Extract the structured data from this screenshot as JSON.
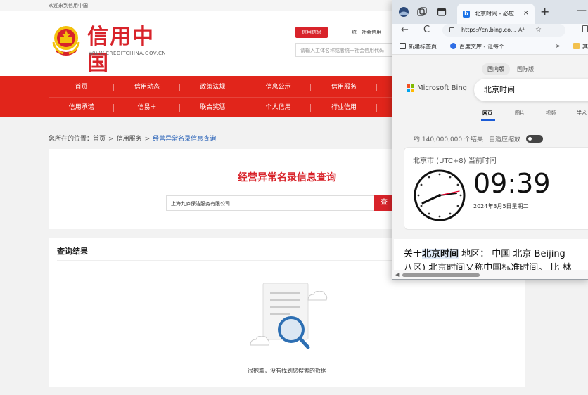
{
  "page": {
    "welcome": "欢迎来到信用中国",
    "logo": {
      "title": "信用中国",
      "subtitle": "WWW.CREDITCHINA.GOV.CN"
    },
    "search_tabs": {
      "active": "信用信息",
      "other": "统一社会信用"
    },
    "search_placeholder": "请输入主体名称或者统一社会信用代码",
    "nav_row1": [
      "首页",
      "信用动态",
      "政策法规",
      "信息公示",
      "信用服务",
      ""
    ],
    "nav_row2": [
      "信用承诺",
      "信易＋",
      "联合奖惩",
      "个人信用",
      "行业信用",
      ""
    ],
    "breadcrumb": {
      "prefix": "您所在的位置：",
      "home": "首页",
      "section": "信用服务",
      "current": "经营异常名录信息查询"
    },
    "query": {
      "title": "经营异常名录信息查询",
      "input_value": "上海九庐保洁服务有限公司",
      "button": "查"
    },
    "results": {
      "heading": "查询结果",
      "empty_text": "很抱歉，没有找到您搜索的数据"
    }
  },
  "browser": {
    "tab_title": "北京时间 - 必应",
    "tab_close": "×",
    "new_tab": "+",
    "minimize": "—",
    "back": "←",
    "reload": "C",
    "url": "https://cn.bing.co...",
    "read_aloud": "A⁴",
    "favorites": [
      {
        "label": "新建标签页",
        "icon": "new-tab-icon"
      },
      {
        "label": "百度文库 - 让每个...",
        "icon": "baidu-wenku-icon"
      }
    ],
    "fav_more": ">",
    "fav_folder_label": "其",
    "bing": {
      "region_tabs": [
        "国内版",
        "国际版"
      ],
      "brand": "Microsoft Bing",
      "query": "北京时间",
      "scopes": [
        "网页",
        "图片",
        "视频",
        "学术"
      ],
      "result_count": "约 140,000,000 个结果",
      "adaptive_zoom": "自适应缩放",
      "timezone": "北京市 (UTC+8) 当前时间",
      "time": "09:39",
      "date": "2024年3月5日星期二",
      "about_prefix": "关于",
      "about_highlight": "北京时间",
      "about_suffix": " 地区： 中国 北京 Beijing",
      "about_line2": "八区) 北京时间又称中国标准时间。 比 林"
    }
  },
  "colors": {
    "brand_red": "#d8232a",
    "nav_red": "#e1251b",
    "bing_blue": "#1a5bd6"
  }
}
